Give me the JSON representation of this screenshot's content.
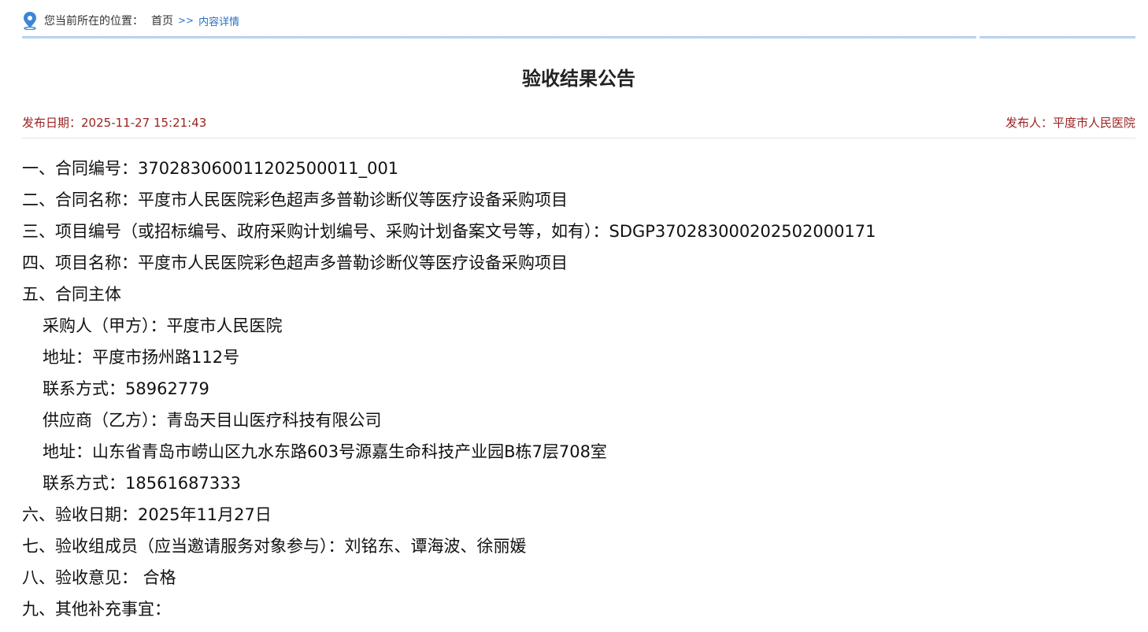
{
  "breadcrumb": {
    "label": "您当前所在的位置：",
    "home": "首页",
    "separator": ">>",
    "current": "内容详情"
  },
  "article": {
    "title": "验收结果公告",
    "publish_date_label": "发布日期：",
    "publish_date": "2025-11-27 15:21:43",
    "publisher_label": "发布人：",
    "publisher": "平度市人民医院"
  },
  "content": {
    "lines": [
      "一、合同编号：370283060011202500011_001",
      "二、合同名称：平度市人民医院彩色超声多普勒诊断仪等医疗设备采购项目",
      "三、项目编号（或招标编号、政府采购计划编号、采购计划备案文号等，如有）：SDGP370283000202502000171",
      "四、项目名称：平度市人民医院彩色超声多普勒诊断仪等医疗设备采购项目",
      "五、合同主体"
    ],
    "subject_lines": [
      "采购人（甲方）：平度市人民医院",
      "地址：平度市扬州路112号",
      "联系方式：58962779",
      "供应商（乙方）：青岛天目山医疗科技有限公司",
      "地址：山东省青岛市崂山区九水东路603号源嘉生命科技产业园B栋7层708室",
      "联系方式：18561687333"
    ],
    "tail_lines": [
      "六、验收日期：2025年11月27日",
      "七、验收组成员（应当邀请服务对象参与）：刘铭东、谭海波、徐丽媛",
      "八、验收意见： 合格",
      "九、其他补充事宜："
    ]
  },
  "colors": {
    "accent_blue": "#2a6fc4",
    "meta_red": "#9b2222",
    "rule_blue": "#a9c8ee"
  },
  "icons": {
    "location": "location-pin-icon"
  }
}
